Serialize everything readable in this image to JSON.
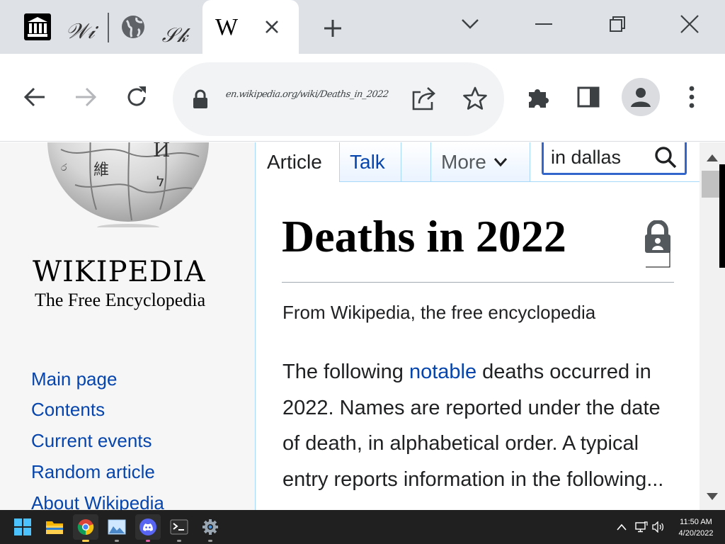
{
  "browser": {
    "tabs": [
      {
        "kind": "icon",
        "icon": "library-icon"
      },
      {
        "kind": "handwriting",
        "text": "𝒲𝒾"
      },
      {
        "kind": "icon",
        "icon": "globe-icon"
      },
      {
        "kind": "handwriting",
        "text": "𝒮𝓀"
      },
      {
        "kind": "active",
        "favicon": "W"
      }
    ],
    "new_tab_icon": "plus-icon",
    "url": "en.wikipedia.org/wiki/Deaths_in_2022",
    "colors": {
      "tabstrip": "#dee1e6",
      "omnibox": "#f1f3f4",
      "icon": "#5f6368"
    }
  },
  "wikipedia": {
    "wordmark": "WIKIPEDIA",
    "tagline": "The Free Encyclopedia",
    "nav": [
      "Main page",
      "Contents",
      "Current events",
      "Random article",
      "About Wikipedia"
    ],
    "tabs": {
      "article": "Article",
      "talk": "Talk",
      "more": "More"
    },
    "search_value": "in dallas",
    "title": "Deaths in 2022",
    "site_sub": "From Wikipedia, the free encyclopedia",
    "lead": {
      "before": "The following ",
      "link": "notable",
      "after": " deaths occurred in 2022. Names are reported under the date of death, in alphabetical order. A typical entry reports information in the following..."
    },
    "colors": {
      "link": "#0645ad",
      "text": "#202122",
      "tab_border": "#a7d7f9"
    }
  },
  "taskbar": {
    "apps": [
      "start-icon",
      "file-explorer-icon",
      "chrome-icon",
      "image-viewer-icon",
      "discord-icon",
      "terminal-icon",
      "settings-icon"
    ],
    "time": "11:50 AM",
    "date": "4/20/2022"
  }
}
